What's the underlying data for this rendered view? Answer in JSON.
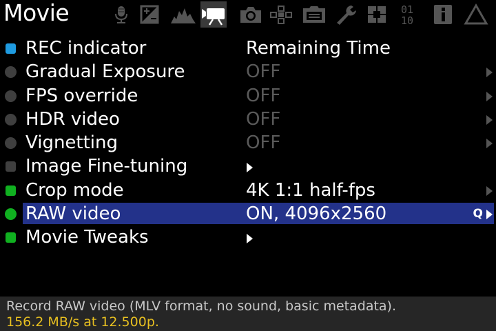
{
  "header": {
    "title": "Movie",
    "tabs": [
      {
        "name": "audio",
        "icon": "microphone-icon",
        "active": false
      },
      {
        "name": "expo",
        "icon": "exposure-icon",
        "active": false
      },
      {
        "name": "overlay",
        "icon": "histogram-icon",
        "active": false
      },
      {
        "name": "movie",
        "icon": "movie-camera-icon",
        "active": true
      },
      {
        "name": "shoot",
        "icon": "camera-icon",
        "active": false
      },
      {
        "name": "focus",
        "icon": "focus-icon",
        "active": false
      },
      {
        "name": "display",
        "icon": "display-icon",
        "active": false
      },
      {
        "name": "prefs",
        "icon": "wrench-icon",
        "active": false
      },
      {
        "name": "modules",
        "icon": "modules-icon",
        "active": false
      },
      {
        "name": "debug",
        "icon": "binary-icon",
        "active": false
      },
      {
        "name": "info",
        "icon": "info-icon",
        "active": false
      },
      {
        "name": "warnings",
        "icon": "warning-icon",
        "active": false
      }
    ]
  },
  "menu": {
    "items": [
      {
        "label": "REC indicator",
        "value": "Remaining Time"
      },
      {
        "label": "Gradual Exposure",
        "value": "OFF"
      },
      {
        "label": "FPS override",
        "value": "OFF"
      },
      {
        "label": "HDR video",
        "value": "OFF"
      },
      {
        "label": "Vignetting",
        "value": "OFF"
      },
      {
        "label": "Image Fine-tuning",
        "value": ""
      },
      {
        "label": "Crop mode",
        "value": "4K 1:1 half-fps"
      },
      {
        "label": "RAW video",
        "value": "ON, 4096x2560",
        "q": "Q"
      },
      {
        "label": "Movie Tweaks",
        "value": ""
      }
    ]
  },
  "help": {
    "line1": "Record RAW video (MLV format, no sound, basic metadata).",
    "line2": "156.2 MB/s at 12.500p."
  },
  "colors": {
    "background": "#000000",
    "selection": "#23328a",
    "active_green": "#10b020",
    "active_blue": "#1f9be0",
    "inactive_gray": "#3f3f3f",
    "off_text": "#5a5a5a",
    "help_bar": "#262626",
    "help_highlight": "#e8c020"
  }
}
